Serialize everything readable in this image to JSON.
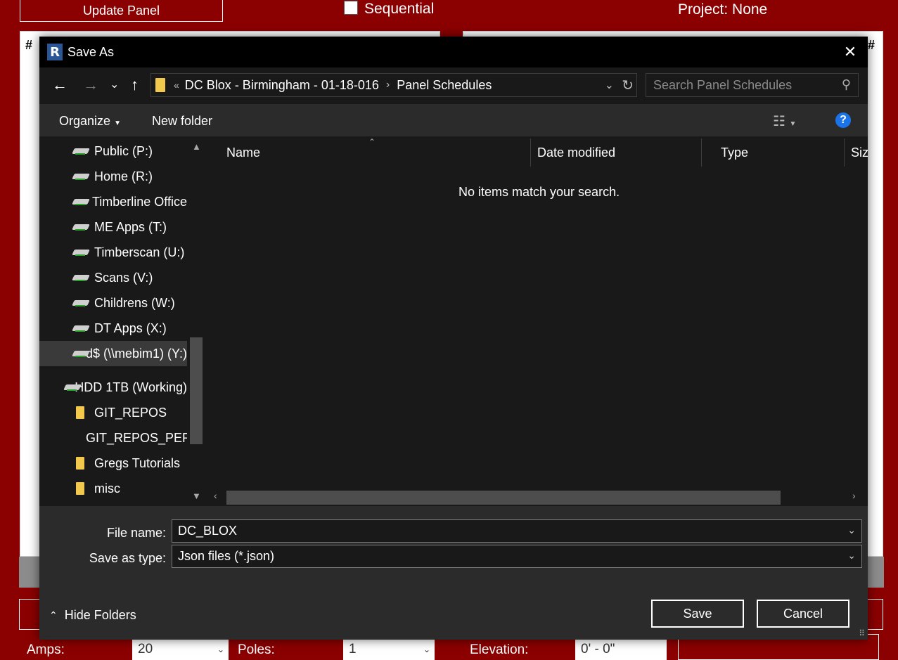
{
  "background": {
    "update_button": "Update Panel",
    "sequential_label": "Sequential",
    "project_label": "Project: None",
    "hash_left": "#",
    "hash_right": "#",
    "amps_label": "Amps:",
    "amps_value": "20",
    "poles_label": "Poles:",
    "poles_value": "1",
    "elevation_label": "Elevation:",
    "elevation_value": "0' - 0\""
  },
  "dialog": {
    "title": "Save As",
    "app_logo": "R",
    "address": {
      "overflow": "«",
      "crumbs": [
        "DC Blox - Birmingham - 01-18-016",
        "Panel Schedules"
      ]
    },
    "search_placeholder": "Search Panel Schedules",
    "toolbar": {
      "organize": "Organize",
      "new_folder": "New folder"
    },
    "nav_items": [
      {
        "label": "Public (P:)",
        "icon": "network-drive-icon"
      },
      {
        "label": "Home (R:)",
        "icon": "network-drive-icon"
      },
      {
        "label": "Timberline Office",
        "icon": "network-drive-icon"
      },
      {
        "label": "ME Apps (T:)",
        "icon": "network-drive-icon"
      },
      {
        "label": "Timberscan (U:)",
        "icon": "network-drive-icon"
      },
      {
        "label": "Scans (V:)",
        "icon": "network-drive-icon"
      },
      {
        "label": "Childrens (W:)",
        "icon": "network-drive-icon"
      },
      {
        "label": "DT Apps (X:)",
        "icon": "network-drive-icon"
      },
      {
        "label": "d$ (\\\\mebim1) (Y:)",
        "icon": "network-drive-icon"
      },
      {
        "label": "HDD 1TB (Working)",
        "icon": "hard-drive-icon"
      },
      {
        "label": "GIT_REPOS",
        "icon": "folder-icon"
      },
      {
        "label": "GIT_REPOS_PERSONAL",
        "icon": "folder-icon"
      },
      {
        "label": "Gregs Tutorials",
        "icon": "folder-icon"
      },
      {
        "label": "misc",
        "icon": "folder-icon"
      }
    ],
    "columns": [
      "Name",
      "Date modified",
      "Type",
      "Size"
    ],
    "empty_message": "No items match your search.",
    "file_name_label": "File name:",
    "file_name_value": "DC_BLOX",
    "save_type_label": "Save as type:",
    "save_type_value": "Json files (*.json)",
    "hide_folders": "Hide Folders",
    "save_button": "Save",
    "cancel_button": "Cancel"
  },
  "colors": {
    "app_background": "#8b0000",
    "dialog_background": "#2b2b2b",
    "pane_background": "#191919",
    "help_blue": "#1a73e8",
    "folder_yellow": "#f2c94c"
  }
}
